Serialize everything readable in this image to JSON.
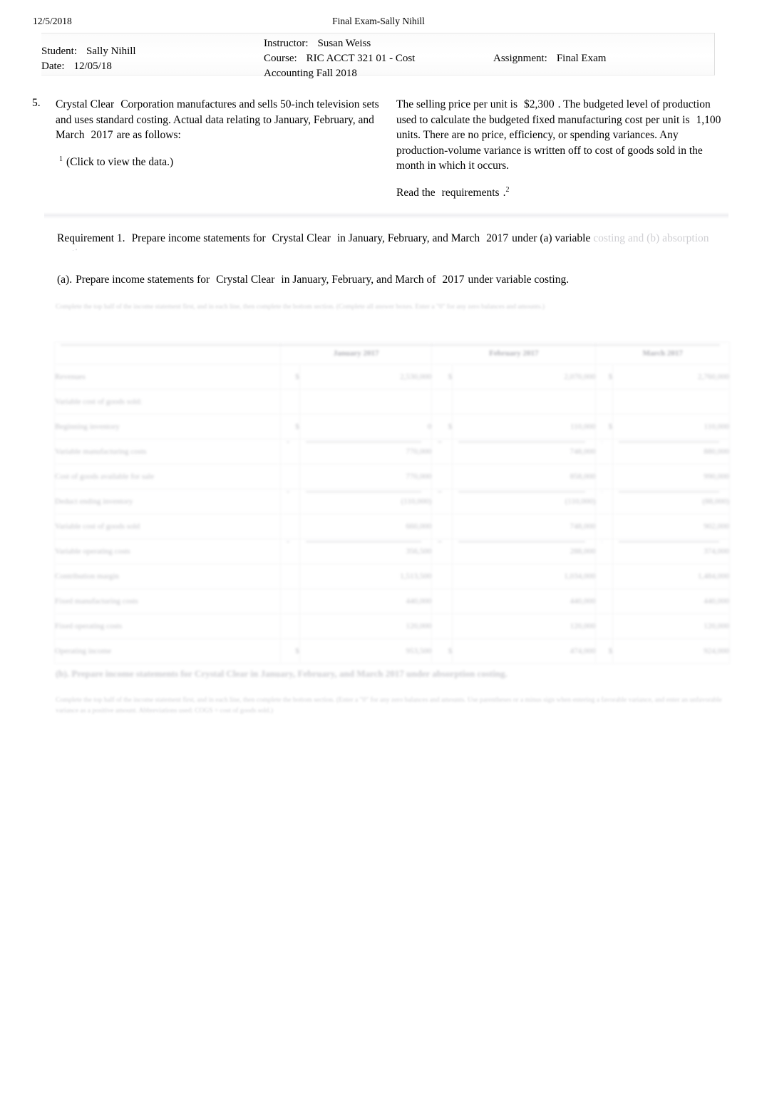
{
  "page_header": {
    "date": "12/5/2018",
    "title": "Final Exam-Sally Nihill"
  },
  "info_box": {
    "student_label": "Student:",
    "student_value": "Sally Nihill",
    "date_label": "Date:",
    "date_value": "12/05/18",
    "instructor_label": "Instructor:",
    "instructor_value": "Susan Weiss",
    "course_label": "Course:",
    "course_value": "RIC ACCT 321 01 - Cost",
    "course_value_line2": "Accounting Fall 2018",
    "assignment_label": "Assignment:",
    "assignment_value": "Final Exam"
  },
  "question": {
    "number": "5.",
    "left": {
      "company": "Crystal Clear",
      "text_1": "Corporation manufactures and sells 50-inch television sets and uses standard costing. Actual data relating to January, February, and March",
      "year": "2017",
      "text_2": "are as follows:",
      "footnote_marker": "1",
      "data_link": "(Click to view the data.)"
    },
    "right": {
      "text_1": "The selling price per unit is",
      "selling_price": "$2,300",
      "text_2": ". The budgeted level of production used to calculate the budgeted fixed manufacturing cost per unit is",
      "budgeted_units": "1,100",
      "text_3": "units. There are no price, efficiency, or spending variances. Any production-volume variance is written off to cost of goods sold in the month in which it occurs.",
      "read_prefix": "Read the",
      "read_link": "requirements",
      "read_suffix": ".",
      "read_footnote_marker": "2"
    }
  },
  "requirement_1": {
    "label": "Requirement 1.",
    "text_1": "Prepare income statements for",
    "company": "Crystal Clear",
    "text_2": "in January, February, and March",
    "year": "2017",
    "text_3": "under (a) variable",
    "clipped_line": "costing and (b) absorption costing."
  },
  "part_a": {
    "marker": "(a).",
    "text_1": "Prepare income statements for",
    "company": "Crystal Clear",
    "text_2": "in January, February, and March of",
    "year": "2017",
    "text_3": "under variable costing."
  },
  "faded_instruction_1": "Complete the top half of the income statement first, and in each line, then complete the bottom section. (Complete all answer boxes. Enter a \"0\" for any zero balances and amounts.)",
  "table": {
    "column_headers": [
      "",
      "January 2017",
      "February 2017",
      "March 2017"
    ],
    "rows": [
      {
        "label": "Revenues",
        "indent": 0,
        "cells": [
          {
            "sym": "$",
            "num": "2,530,000",
            "rule": "none"
          },
          {
            "sym": "$",
            "num": "2,070,000",
            "rule": "none"
          },
          {
            "sym": "$",
            "num": "2,760,000",
            "rule": "none"
          }
        ]
      },
      {
        "label": "Variable cost of goods sold:",
        "indent": 0,
        "cells": [
          {
            "sym": "",
            "num": "",
            "rule": "none"
          },
          {
            "sym": "",
            "num": "",
            "rule": "none"
          },
          {
            "sym": "",
            "num": "",
            "rule": "none"
          }
        ]
      },
      {
        "label": "Beginning inventory",
        "indent": 1,
        "cells": [
          {
            "sym": "$",
            "num": "0",
            "rule": "none"
          },
          {
            "sym": "$",
            "num": "110,000",
            "rule": "none"
          },
          {
            "sym": "$",
            "num": "110,000",
            "rule": "none"
          }
        ]
      },
      {
        "label": "Variable manufacturing costs",
        "indent": 1,
        "cells": [
          {
            "sym": "",
            "num": "770,000",
            "rule": "top"
          },
          {
            "sym": "",
            "num": "748,000",
            "rule": "top"
          },
          {
            "sym": "",
            "num": "880,000",
            "rule": "top"
          }
        ]
      },
      {
        "label": "Cost of goods available for sale",
        "indent": 1,
        "cells": [
          {
            "sym": "",
            "num": "770,000",
            "rule": "none"
          },
          {
            "sym": "",
            "num": "858,000",
            "rule": "none"
          },
          {
            "sym": "",
            "num": "990,000",
            "rule": "none"
          }
        ]
      },
      {
        "label": "Deduct ending inventory",
        "indent": 1,
        "cells": [
          {
            "sym": "",
            "num": "(110,000)",
            "rule": "top"
          },
          {
            "sym": "",
            "num": "(110,000)",
            "rule": "top"
          },
          {
            "sym": "",
            "num": "(88,000)",
            "rule": "top"
          }
        ]
      },
      {
        "label": "Variable cost of goods sold",
        "indent": 2,
        "cells": [
          {
            "sym": "",
            "num": "660,000",
            "rule": "none"
          },
          {
            "sym": "",
            "num": "748,000",
            "rule": "none"
          },
          {
            "sym": "",
            "num": "902,000",
            "rule": "none"
          }
        ]
      },
      {
        "label": "Variable operating costs",
        "indent": 0,
        "cells": [
          {
            "sym": "",
            "num": "356,500",
            "rule": "top"
          },
          {
            "sym": "",
            "num": "288,000",
            "rule": "top"
          },
          {
            "sym": "",
            "num": "374,000",
            "rule": "top"
          }
        ]
      },
      {
        "label": "Contribution margin",
        "indent": 0,
        "cells": [
          {
            "sym": "",
            "num": "1,513,500",
            "rule": "none"
          },
          {
            "sym": "",
            "num": "1,034,000",
            "rule": "none"
          },
          {
            "sym": "",
            "num": "1,484,000",
            "rule": "none"
          }
        ]
      },
      {
        "label": "Fixed manufacturing costs",
        "indent": 0,
        "cells": [
          {
            "sym": "",
            "num": "440,000",
            "rule": "none"
          },
          {
            "sym": "",
            "num": "440,000",
            "rule": "none"
          },
          {
            "sym": "",
            "num": "440,000",
            "rule": "none"
          }
        ]
      },
      {
        "label": "Fixed operating costs",
        "indent": 0,
        "cells": [
          {
            "sym": "",
            "num": "120,000",
            "rule": "none"
          },
          {
            "sym": "",
            "num": "120,000",
            "rule": "none"
          },
          {
            "sym": "",
            "num": "120,000",
            "rule": "none"
          }
        ]
      },
      {
        "label": "Operating income",
        "indent": 0,
        "cells": [
          {
            "sym": "$",
            "num": "953,500",
            "rule": "double"
          },
          {
            "sym": "$",
            "num": "474,000",
            "rule": "double"
          },
          {
            "sym": "$",
            "num": "924,000",
            "rule": "double"
          }
        ]
      }
    ]
  },
  "part_b": "(b). Prepare income statements for Crystal Clear in January, February, and March 2017 under absorption costing.",
  "faded_instruction_2": "Complete the top half of the income statement first, and in each line, then complete the bottom section. (Enter a \"0\" for any zero balances and amounts. Use parentheses or a minus sign when entering a favorable variance, and enter an unfavorable variance as a positive amount. Abbreviations used: COGS = cost of goods sold.)"
}
